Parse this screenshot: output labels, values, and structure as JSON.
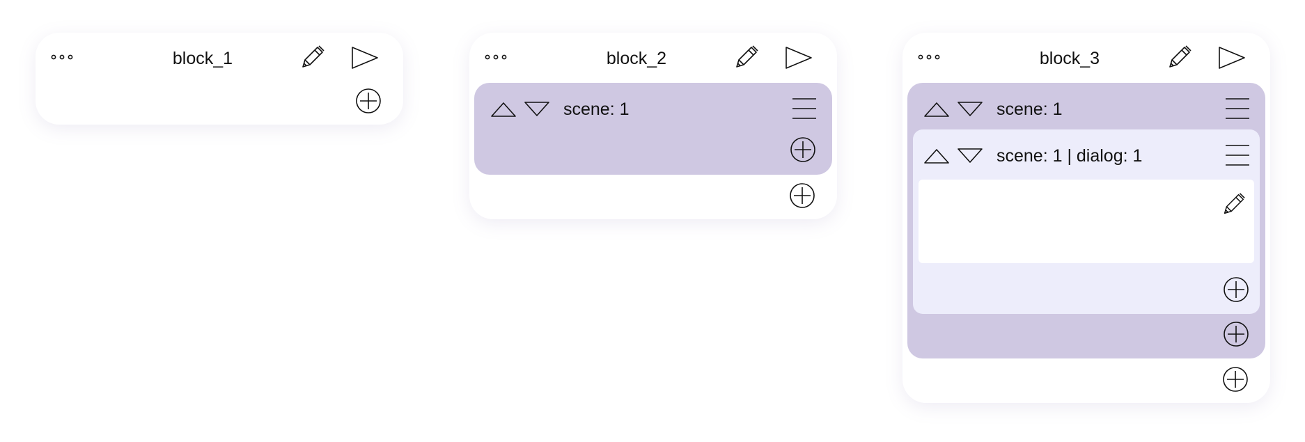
{
  "blocks": [
    {
      "title": "block_1"
    },
    {
      "title": "block_2",
      "scene": {
        "label": "scene: 1"
      }
    },
    {
      "title": "block_3",
      "scene": {
        "label": "scene: 1",
        "dialog": {
          "label": "scene: 1 | dialog: 1"
        }
      }
    }
  ],
  "colors": {
    "block_background": "#ffffff",
    "scene_background": "#cfc8e2",
    "dialog_background": "#ededfb",
    "dialog_body_background": "#ffffff",
    "icon_stroke": "#111111"
  },
  "icons": {
    "more": "more-dots-icon",
    "edit": "pencil-icon",
    "run": "play-icon",
    "add": "plus-circle-icon",
    "move_up": "triangle-up-icon",
    "move_down": "triangle-down-icon",
    "menu": "hamburger-menu-icon"
  }
}
